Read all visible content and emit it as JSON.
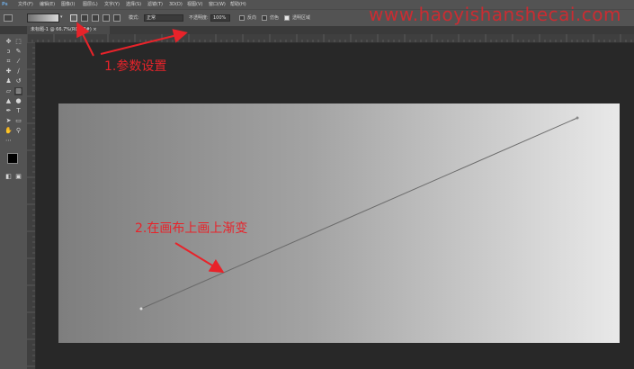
{
  "menu": [
    "文件(F)",
    "编辑(E)",
    "图像(I)",
    "图层(L)",
    "文字(Y)",
    "选择(S)",
    "滤镜(T)",
    "3D(D)",
    "视图(V)",
    "窗口(W)",
    "帮助(H)"
  ],
  "options": {
    "mode_label": "模式:",
    "mode_value": "正常",
    "opacity_label": "不透明度:",
    "opacity_value": "100%",
    "reverse_label": "反向",
    "dither_label": "仿色",
    "transparency_label": "透明区域"
  },
  "document_tab": "未标题-1 @ 66.7%(RGB/8#) ×",
  "annotations": {
    "step1": "1.参数设置",
    "step2": "2.在画布上画上渐变"
  },
  "watermark": "www.haoyishanshecai.com",
  "colors": {
    "accent_red": "#e8232a",
    "foreground": "#000000",
    "background": "#ffffff"
  },
  "icons": [
    "move-icon",
    "marquee-icon",
    "lasso-icon",
    "quick-select-icon",
    "crop-icon",
    "eyedropper-icon",
    "healing-icon",
    "brush-icon",
    "stamp-icon",
    "history-brush-icon",
    "eraser-icon",
    "gradient-icon",
    "blur-icon",
    "dodge-icon",
    "pen-icon",
    "type-icon",
    "path-select-icon",
    "shape-icon",
    "hand-icon",
    "zoom-icon"
  ]
}
